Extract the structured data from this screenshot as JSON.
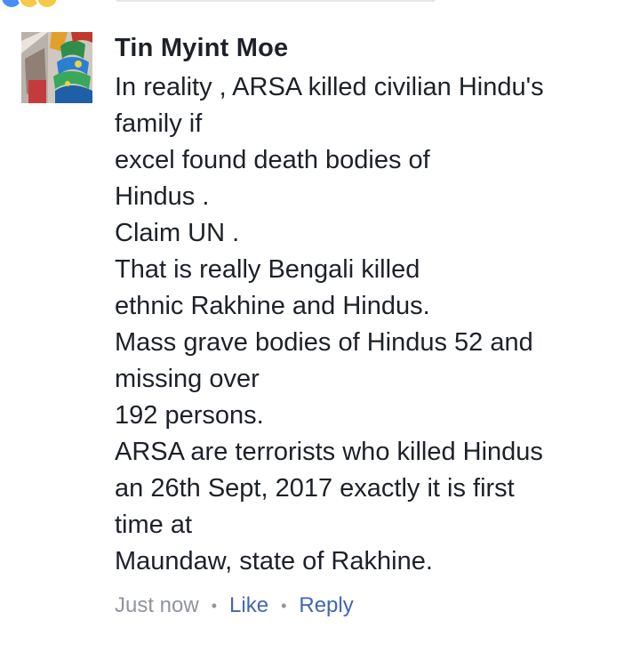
{
  "comment": {
    "author": "Tin Myint Moe",
    "avatar_icon": "profile-avatar-icon",
    "lines": [
      "In reality , ARSA killed civilian Hindu's",
      "family if",
      "excel found death bodies of",
      "Hindus .",
      "Claim UN .",
      "That is really Bengali killed",
      "ethnic Rakhine and Hindus.",
      "Mass grave bodies of Hindus 52 and",
      "missing over",
      "192 persons.",
      "ARSA are terrorists who killed Hindus",
      "an 26th Sept, 2017 exactly it is first",
      "time at",
      "Maundaw, state of Rakhine."
    ],
    "timestamp": "Just now",
    "separator": "•",
    "like_label": "Like",
    "reply_label": "Reply"
  },
  "colors": {
    "text": "#1d2129",
    "meta": "#90949c",
    "link": "#4267b2"
  }
}
